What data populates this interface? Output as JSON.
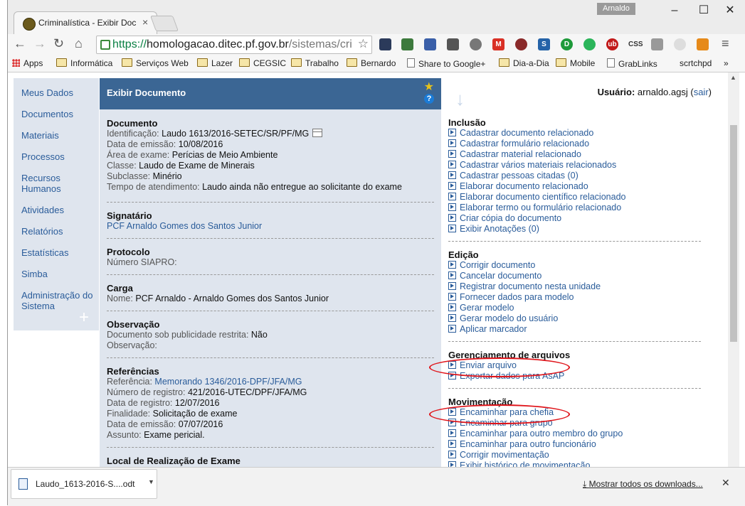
{
  "window": {
    "tab_title": "Criminalística - Exibir Doc",
    "user_badge": "Arnaldo",
    "url_scheme": "https://",
    "url_host": "homologacao.ditec.pf.gov.br",
    "url_path": "/sistemas/cri"
  },
  "bookmarks": [
    "Apps",
    "Informática",
    "Serviços Web",
    "Lazer",
    "CEGSIC",
    "Trabalho",
    "Bernardo",
    "Share to Google+",
    "Dia-a-Dia",
    "Mobile",
    "GrabLinks",
    "scrtchpd"
  ],
  "sidebar": [
    "Meus Dados",
    "Documentos",
    "Materiais",
    "Processos",
    "Recursos Humanos",
    "Atividades",
    "Relatórios",
    "Estatísticas",
    "Simba",
    "Administração do Sistema"
  ],
  "header": {
    "title": "Exibir Documento"
  },
  "documento": {
    "heading": "Documento",
    "identificacao_lbl": "Identificação:",
    "identificacao": "Laudo 1613/2016-SETEC/SR/PF/MG",
    "emissao_lbl": "Data de emissão:",
    "emissao": "10/08/2016",
    "area_lbl": "Área de exame:",
    "area": "Perícias de Meio Ambiente",
    "classe_lbl": "Classe:",
    "classe": "Laudo de Exame de Minerais",
    "subclasse_lbl": "Subclasse:",
    "subclasse": "Minério",
    "tempo_lbl": "Tempo de atendimento:",
    "tempo": "Laudo ainda não entregue ao solicitante do exame"
  },
  "signatario": {
    "heading": "Signatário",
    "name": "PCF Arnaldo Gomes dos Santos Junior"
  },
  "protocolo": {
    "heading": "Protocolo",
    "siapro_lbl": "Número SIAPRO:"
  },
  "carga": {
    "heading": "Carga",
    "nome_lbl": "Nome:",
    "nome": "PCF Arnaldo - Arnaldo Gomes dos Santos Junior"
  },
  "observacao": {
    "heading": "Observação",
    "restrita_lbl": "Documento sob publicidade restrita:",
    "restrita": "Não",
    "obs_lbl": "Observação:"
  },
  "referencias": {
    "heading": "Referências",
    "ref_lbl": "Referência:",
    "ref": "Memorando 1346/2016-DPF/JFA/MG",
    "registro_lbl": "Número de registro:",
    "registro": "421/2016-UTEC/DPF/JFA/MG",
    "data_registro_lbl": "Data de registro:",
    "data_registro": "12/07/2016",
    "finalidade_lbl": "Finalidade:",
    "finalidade": "Solicitação de exame",
    "emissao_lbl": "Data de emissão:",
    "emissao": "07/07/2016",
    "assunto_lbl": "Assunto:",
    "assunto": "Exame pericial."
  },
  "local": {
    "heading": "Local de Realização de Exame"
  },
  "user": {
    "label": "Usuário:",
    "name": "arnaldo.agsj",
    "logout": "sair"
  },
  "inclusao": {
    "heading": "Inclusão",
    "actions": [
      "Cadastrar documento relacionado",
      "Cadastrar formulário relacionado",
      "Cadastrar material relacionado",
      "Cadastrar vários materiais relacionados",
      "Cadastrar pessoas citadas (0)",
      "Elaborar documento relacionado",
      "Elaborar documento científico relacionado",
      "Elaborar termo ou formulário relacionado",
      "Criar cópia do documento",
      "Exibir Anotações (0)"
    ]
  },
  "edicao": {
    "heading": "Edição",
    "actions": [
      "Corrigir documento",
      "Cancelar documento",
      "Registrar documento nesta unidade",
      "Fornecer dados para modelo",
      "Gerar modelo",
      "Gerar modelo do usuário",
      "Aplicar marcador"
    ]
  },
  "arquivos": {
    "heading": "Gerenciamento de arquivos",
    "actions": [
      "Enviar arquivo",
      "Exportar dados para AsAP"
    ]
  },
  "movimentacao": {
    "heading": "Movimentação",
    "actions": [
      "Encaminhar para chefia",
      "Encaminhar para grupo",
      "Encaminhar para outro membro do grupo",
      "Encaminhar para outro funcionário",
      "Corrigir movimentação",
      "Exibir histórico de movimentação"
    ]
  },
  "downloads": {
    "file": "Laudo_1613-2016-S....odt",
    "show_all": "Mostrar todos os downloads..."
  }
}
